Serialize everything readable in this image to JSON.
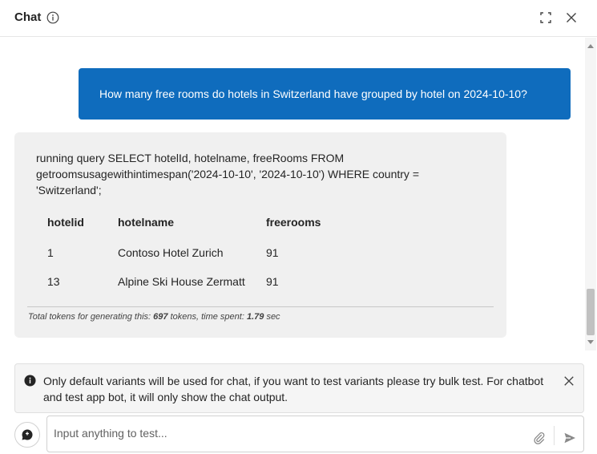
{
  "header": {
    "title": "Chat",
    "icons": [
      "info-icon",
      "expand-icon",
      "close-icon"
    ]
  },
  "messages": {
    "user": "How many free rooms do hotels in Switzerland have grouped by hotel on 2024-10-10?",
    "bot": {
      "query_text": "running query SELECT hotelId, hotelname, freeRooms FROM getroomsusagewithintimespan('2024-10-10', '2024-10-10') WHERE country = 'Switzerland';",
      "table": {
        "columns": [
          "hotelid",
          "hotelname",
          "freerooms"
        ],
        "rows": [
          [
            "1",
            "Contoso Hotel Zurich",
            "91"
          ],
          [
            "13",
            "Alpine Ski House Zermatt",
            "91"
          ]
        ]
      },
      "tokens": {
        "prefix": "Total tokens for generating this:",
        "count": "697",
        "middle": "tokens, time spent:",
        "time": "1.79",
        "suffix": "sec"
      }
    }
  },
  "notice": {
    "text": "Only default variants will be used for chat, if you want to test variants please try bulk test. For chatbot and test app bot, it will only show the chat output."
  },
  "input": {
    "placeholder": "Input anything to test...",
    "value": ""
  },
  "colors": {
    "user_bubble": "#0f6cbd",
    "bot_bubble": "#f0f0f0",
    "notice_bg": "#f5f5f5"
  }
}
